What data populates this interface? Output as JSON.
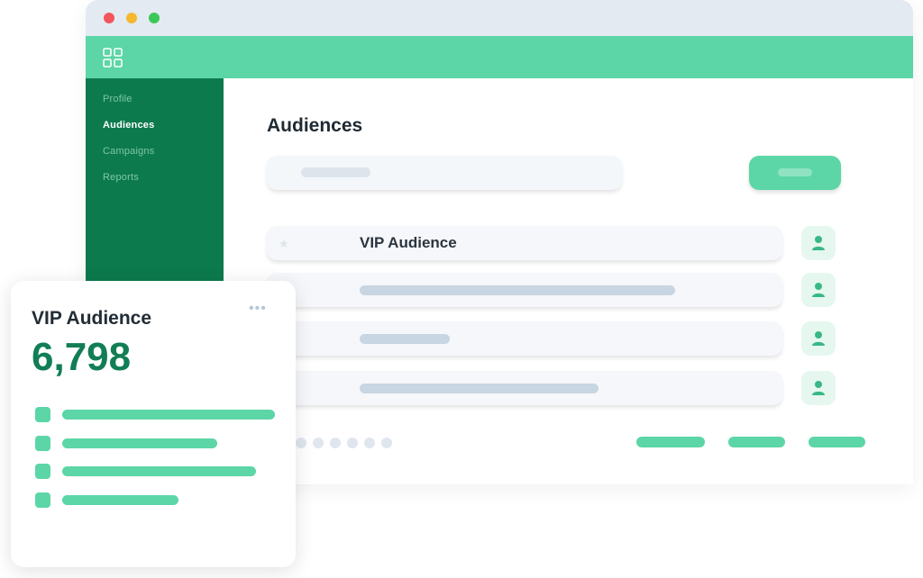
{
  "window": {
    "controls": {
      "close_color": "#f2555a",
      "minimize_color": "#f5b82e",
      "maximize_color": "#3cc858"
    },
    "topbar": {
      "icon": "grid-icon",
      "color": "#5cd6a6"
    }
  },
  "sidebar": {
    "color": "#0c7a4d",
    "items": [
      {
        "label": "Profile",
        "active": false
      },
      {
        "label": "Audiences",
        "active": true
      },
      {
        "label": "Campaigns",
        "active": false
      },
      {
        "label": "Reports",
        "active": false
      }
    ]
  },
  "main": {
    "title": "Audiences",
    "rows": [
      {
        "label": "VIP Audience",
        "icon": "star-icon",
        "action_icon": "user-icon"
      },
      {
        "label": "",
        "action_icon": "user-icon"
      },
      {
        "label": "",
        "action_icon": "user-icon"
      },
      {
        "label": "",
        "action_icon": "user-icon"
      }
    ]
  },
  "card": {
    "title": "VIP Audience",
    "value": "6,798",
    "more_icon": "more-icon",
    "accent": "#127e55"
  },
  "colors": {
    "accent": "#5cd6a6",
    "brand_dark": "#0c7a4d"
  }
}
